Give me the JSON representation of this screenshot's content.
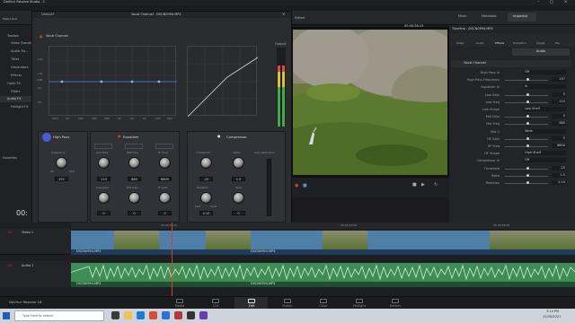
{
  "window_title": "DaVinci Resolve Studio - 1",
  "menu": [
    "DaVinci Resolve",
    "File",
    "Edit",
    "Trim",
    "Timeline",
    "Clip",
    "Mark",
    "View",
    "Playback",
    "Fusion",
    "Color",
    "Fairlight",
    "Workspace",
    "Help"
  ],
  "toolbar": {
    "media_pool": "Media Pool",
    "effects_library": "Effects Library",
    "edit_index": "Edit Index",
    "sound_library": "Sound Library",
    "mixer": "Mixer",
    "metadata": "Metadata",
    "inspector": "Inspector"
  },
  "viewer": {
    "timecode": "00:00:28:15",
    "title": "Edited"
  },
  "left_sidebar": {
    "toolbox": "Toolbox",
    "video_transitions": "Video Transitions",
    "audio_transitions": "Audio Tra...",
    "titles": "Titles",
    "generators": "Generators",
    "effects": "Effects",
    "open_fx": "Open FX",
    "filters": "Filters",
    "audio_fx": "Audio FX",
    "fairlight_fx": "Fairlight FX",
    "favorites": "Favorites"
  },
  "plugin": {
    "preset": "Default*",
    "title": "Vocal Channel - DSCN0994.MP4",
    "section": "Vocal Channel",
    "output": "Output",
    "graph_x_ticks": [
      "30m",
      "50",
      "100",
      "200",
      "500",
      "1k",
      "2k",
      "5k",
      "10k",
      "20k"
    ],
    "graph_y_ticks": [
      "+24",
      "+12",
      "0dB",
      "-12",
      "-24"
    ],
    "high_pass": {
      "title": "High Pass",
      "frequency_label": "Frequency",
      "frequency_value": "297",
      "min": "20",
      "max": "500"
    },
    "equalizer": {
      "title": "Equalizer",
      "low_freq": "Low Freq",
      "mid_freq": "Mid Freq",
      "hi_freq": "Hi Freq",
      "low_freq_value": "110",
      "mid_freq_value": "880",
      "hi_freq_value": "6800",
      "low_gain": "Low Gain",
      "mid_gain": "Mid Gain",
      "hi_gain": "Hi Gain",
      "low_gain_value": "0",
      "mid_gain_value": "0",
      "hi_gain_value": "0"
    },
    "compressor": {
      "title": "Compressor",
      "threshold": "Threshold",
      "ratio": "Ratio",
      "gain_reduction": "Gain Reduction",
      "threshold_value": "-25",
      "ratio_value": "1.5",
      "reaction": "Reaction",
      "gain": "Gain",
      "reaction_value": "0.10",
      "gain_value": "0",
      "fast": "Fast",
      "slow": "Slow"
    }
  },
  "inspector": {
    "header": "Timeline - DSCN0994.MP4",
    "tabs": [
      "Video",
      "Audio",
      "Effects",
      "Transition",
      "Image",
      "File"
    ],
    "subtabs": [
      "Audio"
    ],
    "section": "Vocal Channel",
    "rows": [
      {
        "label": "High Pass In",
        "value": "Off"
      },
      {
        "label": "High Pass Frequency",
        "value": "297"
      },
      {
        "label": "Equalizer In",
        "value": "In"
      },
      {
        "label": "Low Gain",
        "value": "0"
      },
      {
        "label": "Low Freq",
        "value": "110"
      },
      {
        "label": "Low Shape",
        "value": "Low Shelf"
      },
      {
        "label": "Mid Gain",
        "value": "0"
      },
      {
        "label": "Mid Freq",
        "value": "880"
      },
      {
        "label": "Mid Q",
        "value": "Wide"
      },
      {
        "label": "HF Gain",
        "value": "0"
      },
      {
        "label": "HF Freq",
        "value": "6800"
      },
      {
        "label": "HF Shape",
        "value": "High Shelf"
      },
      {
        "label": "Compressor In",
        "value": "Off"
      },
      {
        "label": "Threshold",
        "value": "-25"
      },
      {
        "label": "Ratio",
        "value": "1.5"
      },
      {
        "label": "Reaction",
        "value": "0.10"
      }
    ]
  },
  "timeline": {
    "timecode": "00:",
    "ruler": [
      "00:00:16:00",
      "00:00:40:00",
      "00:00:56:00"
    ],
    "video_track": "Video 1",
    "audio_track": "Audio 1",
    "clip_names": [
      "DSCN0994.MP4",
      "DSCN0994.MP4",
      "DSCN0994.MP4",
      "DSCN0994.MP4"
    ]
  },
  "pages": [
    "Media",
    "Cut",
    "Edit",
    "Fusion",
    "Color",
    "Fairlight",
    "Deliver"
  ],
  "active_page": "Edit",
  "footer_app": "DaVinci Resolve 18",
  "taskbar": {
    "search_placeholder": "Type here to search",
    "time": "3:14 PM",
    "date": "12/30/2021"
  },
  "colors": {
    "accent": "#c53b3b",
    "clip_video": "#4f7fa8",
    "clip_audio": "#3d8d54",
    "playhead": "#d23d3d"
  }
}
